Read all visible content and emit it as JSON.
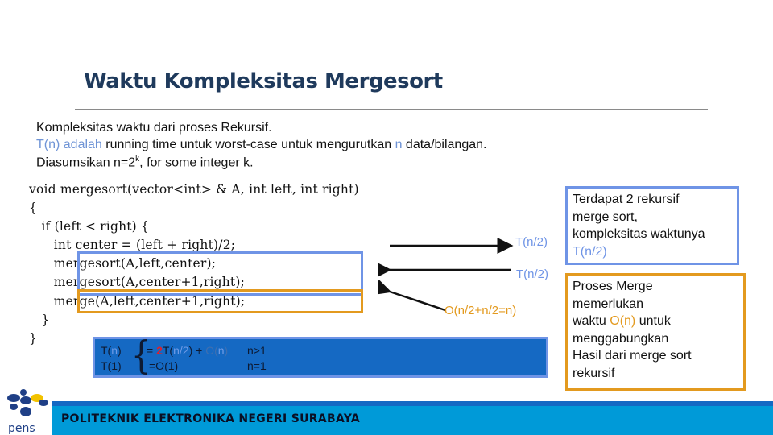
{
  "slide": {
    "title": "Waktu Kompleksitas Mergesort",
    "intro": {
      "line1": "Kompleksitas waktu dari proses Rekursif.",
      "line2_highlight": "T(n) adalah",
      "line2_mid": " running time untuk worst-case untuk mengurutkan  ",
      "line2_n": "n",
      "line2_end": " data/bilangan.",
      "line3_start": "Diasumsikan n=2",
      "line3_sup": "k",
      "line3_end": ", for some integer k."
    },
    "code": [
      "void mergesort(vector<int> & A, int left, int right)",
      "{",
      "   if (left < right) {",
      "      int center = (left + right)/2;",
      "      mergesort(A,left,center);",
      "      mergesort(A,center+1,right);",
      "      merge(A,left,center+1,right);",
      "   }",
      "}"
    ],
    "annotations": {
      "arrow1_label": "T(n/2)",
      "arrow2_label": "T(n/2)",
      "arrow3_label": "O(n/2+n/2=n)"
    },
    "recurrence": {
      "row1_lhs_T": "T(",
      "row1_lhs_n": "n",
      "row1_lhs_close": ")",
      "row1_eq": "= ",
      "row1_two": "2",
      "row1_T": "T(",
      "row1_n2": "n/2",
      "row1_close": ") + ",
      "row1_O": "O(",
      "row1_n": "n",
      "row1_Oclose": ")",
      "row1_cond": "n>1",
      "row2_lhs": "T(1)",
      "row2_rhs": "=O(1)",
      "row2_cond": "n=1"
    },
    "side_box_1": {
      "lines": [
        "Terdapat 2 rekursif",
        "merge sort,",
        "kompleksitas waktunya"
      ],
      "highlight": "T(n/2)"
    },
    "side_box_2": {
      "line1": "Proses Merge",
      "line2": "memerlukan",
      "line3_start": "waktu ",
      "line3_highlight": "O(n)",
      "line3_end": " untuk",
      "line4": "menggabungkan",
      "line5": "Hasil dari merge sort",
      "line6": "rekursif"
    },
    "footer": {
      "institution": "POLITEKNIK ELEKTRONIKA NEGERI SURABAYA",
      "logo_text": "pens",
      "logo_icon": "pens-logo-icon"
    },
    "colors": {
      "title": "#1f3a5c",
      "accent_blue": "#6f94e6",
      "accent_orange": "#e39a1f",
      "formula_bg": "#1569c3",
      "footer_bg": "#009ad8",
      "red": "#e0202a"
    }
  }
}
